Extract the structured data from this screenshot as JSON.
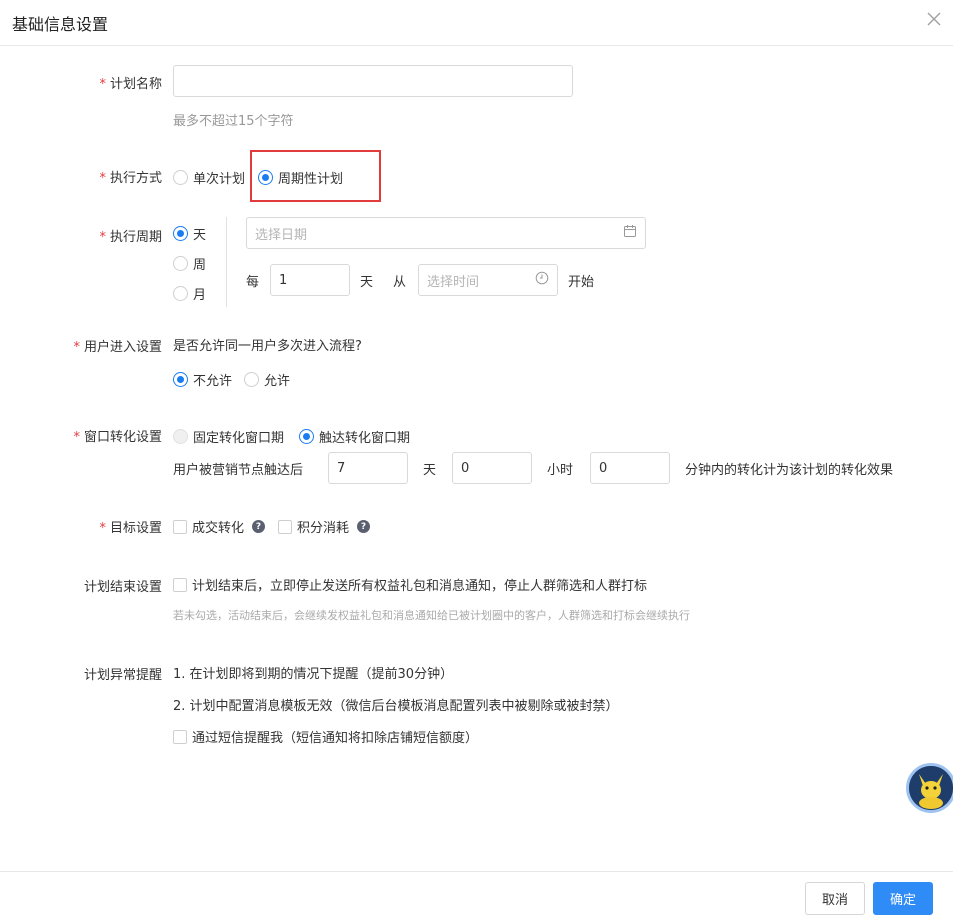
{
  "dialog": {
    "title": "基础信息设置"
  },
  "plan_name": {
    "label": "计划名称",
    "value": "",
    "hint": "最多不超过15个字符"
  },
  "exec_mode": {
    "label": "执行方式",
    "options": [
      "单次计划",
      "周期性计划"
    ],
    "selected": "周期性计划"
  },
  "exec_cycle": {
    "label": "执行周期",
    "options": [
      "天",
      "周",
      "月"
    ],
    "selected": "天",
    "date_placeholder": "选择日期",
    "every_label": "每",
    "every_value": "1",
    "unit_label": "天",
    "from_label": "从",
    "time_placeholder": "选择时间",
    "start_label": "开始"
  },
  "user_entry": {
    "label": "用户进入设置",
    "question": "是否允许同一用户多次进入流程?",
    "options": [
      "不允许",
      "允许"
    ],
    "selected": "不允许"
  },
  "window_conversion": {
    "label": "窗口转化设置",
    "options": [
      "固定转化窗口期",
      "触达转化窗口期"
    ],
    "selected": "触达转化窗口期",
    "prefix": "用户被营销节点触达后",
    "days_value": "7",
    "days_label": "天",
    "hours_value": "0",
    "hours_label": "小时",
    "minutes_value": "0",
    "suffix": "分钟内的转化计为该计划的转化效果"
  },
  "goal": {
    "label": "目标设置",
    "options": [
      "成交转化",
      "积分消耗"
    ],
    "help_glyph": "?"
  },
  "plan_end": {
    "label": "计划结束设置",
    "checkbox_label": "计划结束后，立即停止发送所有权益礼包和消息通知，停止人群筛选和人群打标",
    "hint": "若未勾选，活动结束后，会继续发权益礼包和消息通知给已被计划圈中的客户，人群筛选和打标会继续执行"
  },
  "plan_alert": {
    "label": "计划异常提醒",
    "item1": "1. 在计划即将到期的情况下提醒（提前30分钟）",
    "item2": "2. 计划中配置消息模板无效（微信后台模板消息配置列表中被剔除或被封禁）",
    "sms_label": "通过短信提醒我（短信通知将扣除店铺短信额度）"
  },
  "footer": {
    "cancel": "取消",
    "ok": "确定"
  },
  "colors": {
    "primary": "#2f8bf5",
    "required": "#e4393c",
    "highlight_box": "#e23b3b"
  }
}
